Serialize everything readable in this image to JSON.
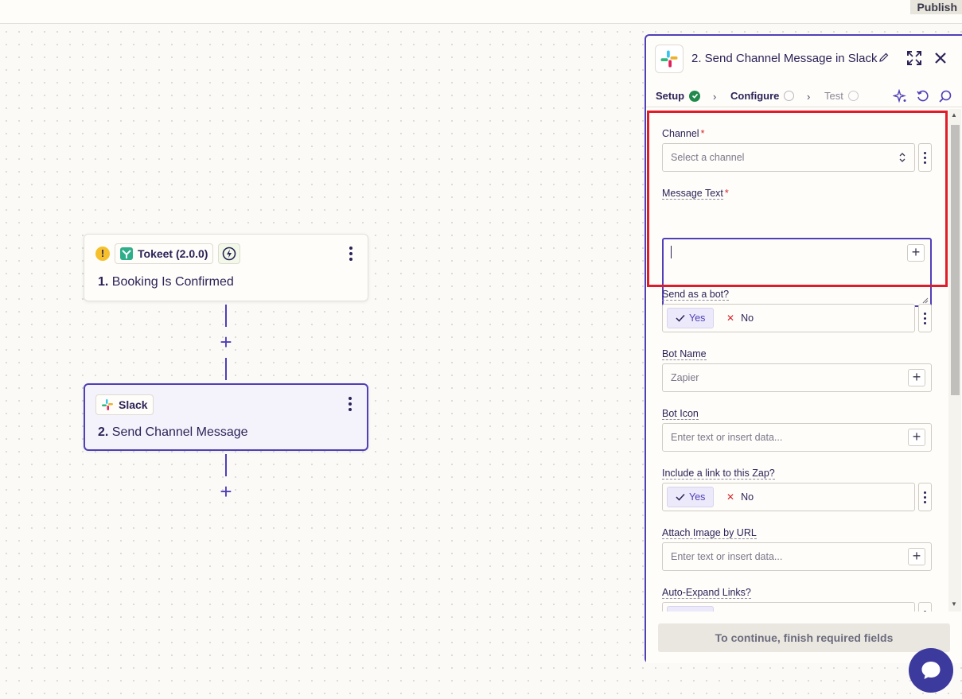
{
  "topbar": {
    "publish_label": "Publish"
  },
  "canvas": {
    "node1": {
      "app_name": "Tokeet (2.0.0)",
      "step_number": "1.",
      "title": "Booking Is Confirmed",
      "warning": "!"
    },
    "node2": {
      "app_name": "Slack",
      "step_number": "2.",
      "title": "Send Channel Message"
    }
  },
  "panel": {
    "title": "2. Send Channel Message in Slack",
    "tabs": [
      {
        "label": "Setup",
        "state": "complete"
      },
      {
        "label": "Configure",
        "state": "pending"
      },
      {
        "label": "Test",
        "state": "disabled"
      }
    ],
    "fields": {
      "channel": {
        "label": "Channel",
        "required": "*",
        "placeholder": "Select a channel"
      },
      "message_text": {
        "label": "Message Text",
        "required": "*"
      },
      "send_as_bot": {
        "label": "Send as a bot?",
        "yes": "Yes",
        "no": "No",
        "selected": "Yes"
      },
      "bot_name": {
        "label": "Bot Name",
        "placeholder": "Zapier"
      },
      "bot_icon": {
        "label": "Bot Icon",
        "placeholder": "Enter text or insert data..."
      },
      "include_link": {
        "label": "Include a link to this Zap?",
        "yes": "Yes",
        "no": "No",
        "selected": "Yes"
      },
      "attach_image": {
        "label": "Attach Image by URL",
        "placeholder": "Enter text or insert data..."
      },
      "auto_expand": {
        "label": "Auto-Expand Links?"
      }
    },
    "footer": {
      "continue_label": "To continue, finish required fields"
    }
  },
  "colors": {
    "accent": "#4f3fb8",
    "highlight": "#e01c2a",
    "success": "#1f8a4c",
    "required": "#d4282f"
  }
}
